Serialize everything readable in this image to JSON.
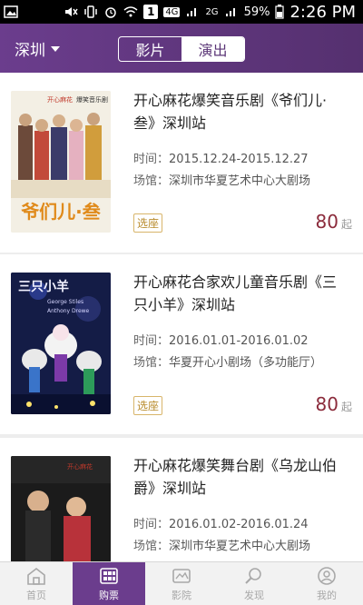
{
  "status_bar": {
    "signal_labels": [
      "4G",
      "2G"
    ],
    "sim_number": "1",
    "battery": "59%",
    "time": "2:26 PM"
  },
  "header": {
    "city": "深圳",
    "tabs": [
      {
        "label": "影片",
        "active": false
      },
      {
        "label": "演出",
        "active": true
      }
    ],
    "colors": {
      "brand": "#6b3d8d"
    }
  },
  "shows": [
    {
      "title": "开心麻花爆笑音乐剧《爷们儿·叁》深圳站",
      "time_label": "时间：",
      "time": "2015.12.24-2015.12.27",
      "venue_label": "场馆：",
      "venue": "深圳市华夏艺术中心大剧场",
      "tag": "选座",
      "price": "80",
      "price_suffix": "起",
      "poster": {
        "logo": "开心麻花",
        "subtitle": "爆笑音乐剧",
        "title": "爷们儿·叁"
      }
    },
    {
      "title": "开心麻花合家欢儿童音乐剧《三只小羊》深圳站",
      "time_label": "时间：",
      "time": "2016.01.01-2016.01.02",
      "venue_label": "场馆：",
      "venue": "华夏开心小剧场（多功能厅）",
      "tag": "选座",
      "price": "80",
      "price_suffix": "起",
      "poster": {
        "title": "三只小羊",
        "credit1": "George Stiles",
        "credit2": "Anthony Drewe"
      }
    },
    {
      "title": "开心麻花爆笑舞台剧《乌龙山伯爵》深圳站",
      "time_label": "时间：",
      "time": "2016.01.02-2016.01.24",
      "venue_label": "场馆：",
      "venue": "深圳市华夏艺术中心大剧场",
      "poster": {
        "logo": "开心麻花"
      }
    }
  ],
  "bottom_nav": [
    {
      "label": "首页",
      "icon": "home-icon",
      "active": false
    },
    {
      "label": "购票",
      "icon": "ticket-grid-icon",
      "active": true
    },
    {
      "label": "影院",
      "icon": "cinema-icon",
      "active": false
    },
    {
      "label": "发现",
      "icon": "discover-icon",
      "active": false
    },
    {
      "label": "我的",
      "icon": "profile-icon",
      "active": false
    }
  ]
}
